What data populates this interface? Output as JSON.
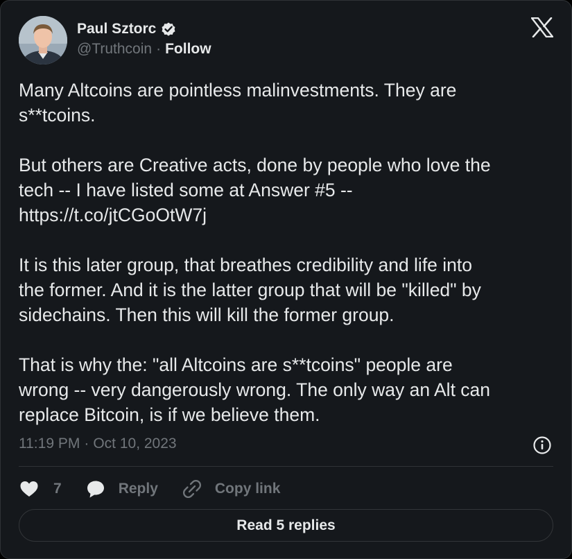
{
  "author": {
    "name": "Paul Sztorc",
    "handle": "@Truthcoin",
    "separator": "·",
    "follow_label": "Follow",
    "verified": true
  },
  "tweet": {
    "paragraphs": [
      [
        "Many Altcoins are pointless malinvestments. They are",
        "s**tcoins."
      ],
      [
        "But others are Creative acts, done by people who love the",
        "tech -- I have listed some at Answer #5 --",
        "https://t.co/jtCGoOtW7j"
      ],
      [
        "It is this later group, that breathes credibility and life into",
        "the former. And it is the latter group that will be \"killed\" by",
        "sidechains. Then this will kill the former group."
      ],
      [
        "That is why the: \"all Altcoins are s**tcoins\" people are",
        "wrong -- very dangerously wrong. The only way an Alt can",
        "replace Bitcoin, is if we believe them."
      ]
    ],
    "time": "11:19 PM",
    "meta_separator": "·",
    "date": "Oct 10, 2023"
  },
  "actions": {
    "like_count": "7",
    "reply_label": "Reply",
    "copy_link_label": "Copy link"
  },
  "read_replies_label": "Read 5 replies",
  "icons": {
    "logo": "x-logo-icon",
    "verified": "verified-badge-icon",
    "info": "info-icon",
    "like": "heart-icon",
    "reply": "speech-bubble-icon",
    "copy_link": "link-icon"
  },
  "colors": {
    "background": "#15181c",
    "text": "#e7e9ea",
    "secondary_text": "#71767b",
    "border": "#2f3336"
  }
}
